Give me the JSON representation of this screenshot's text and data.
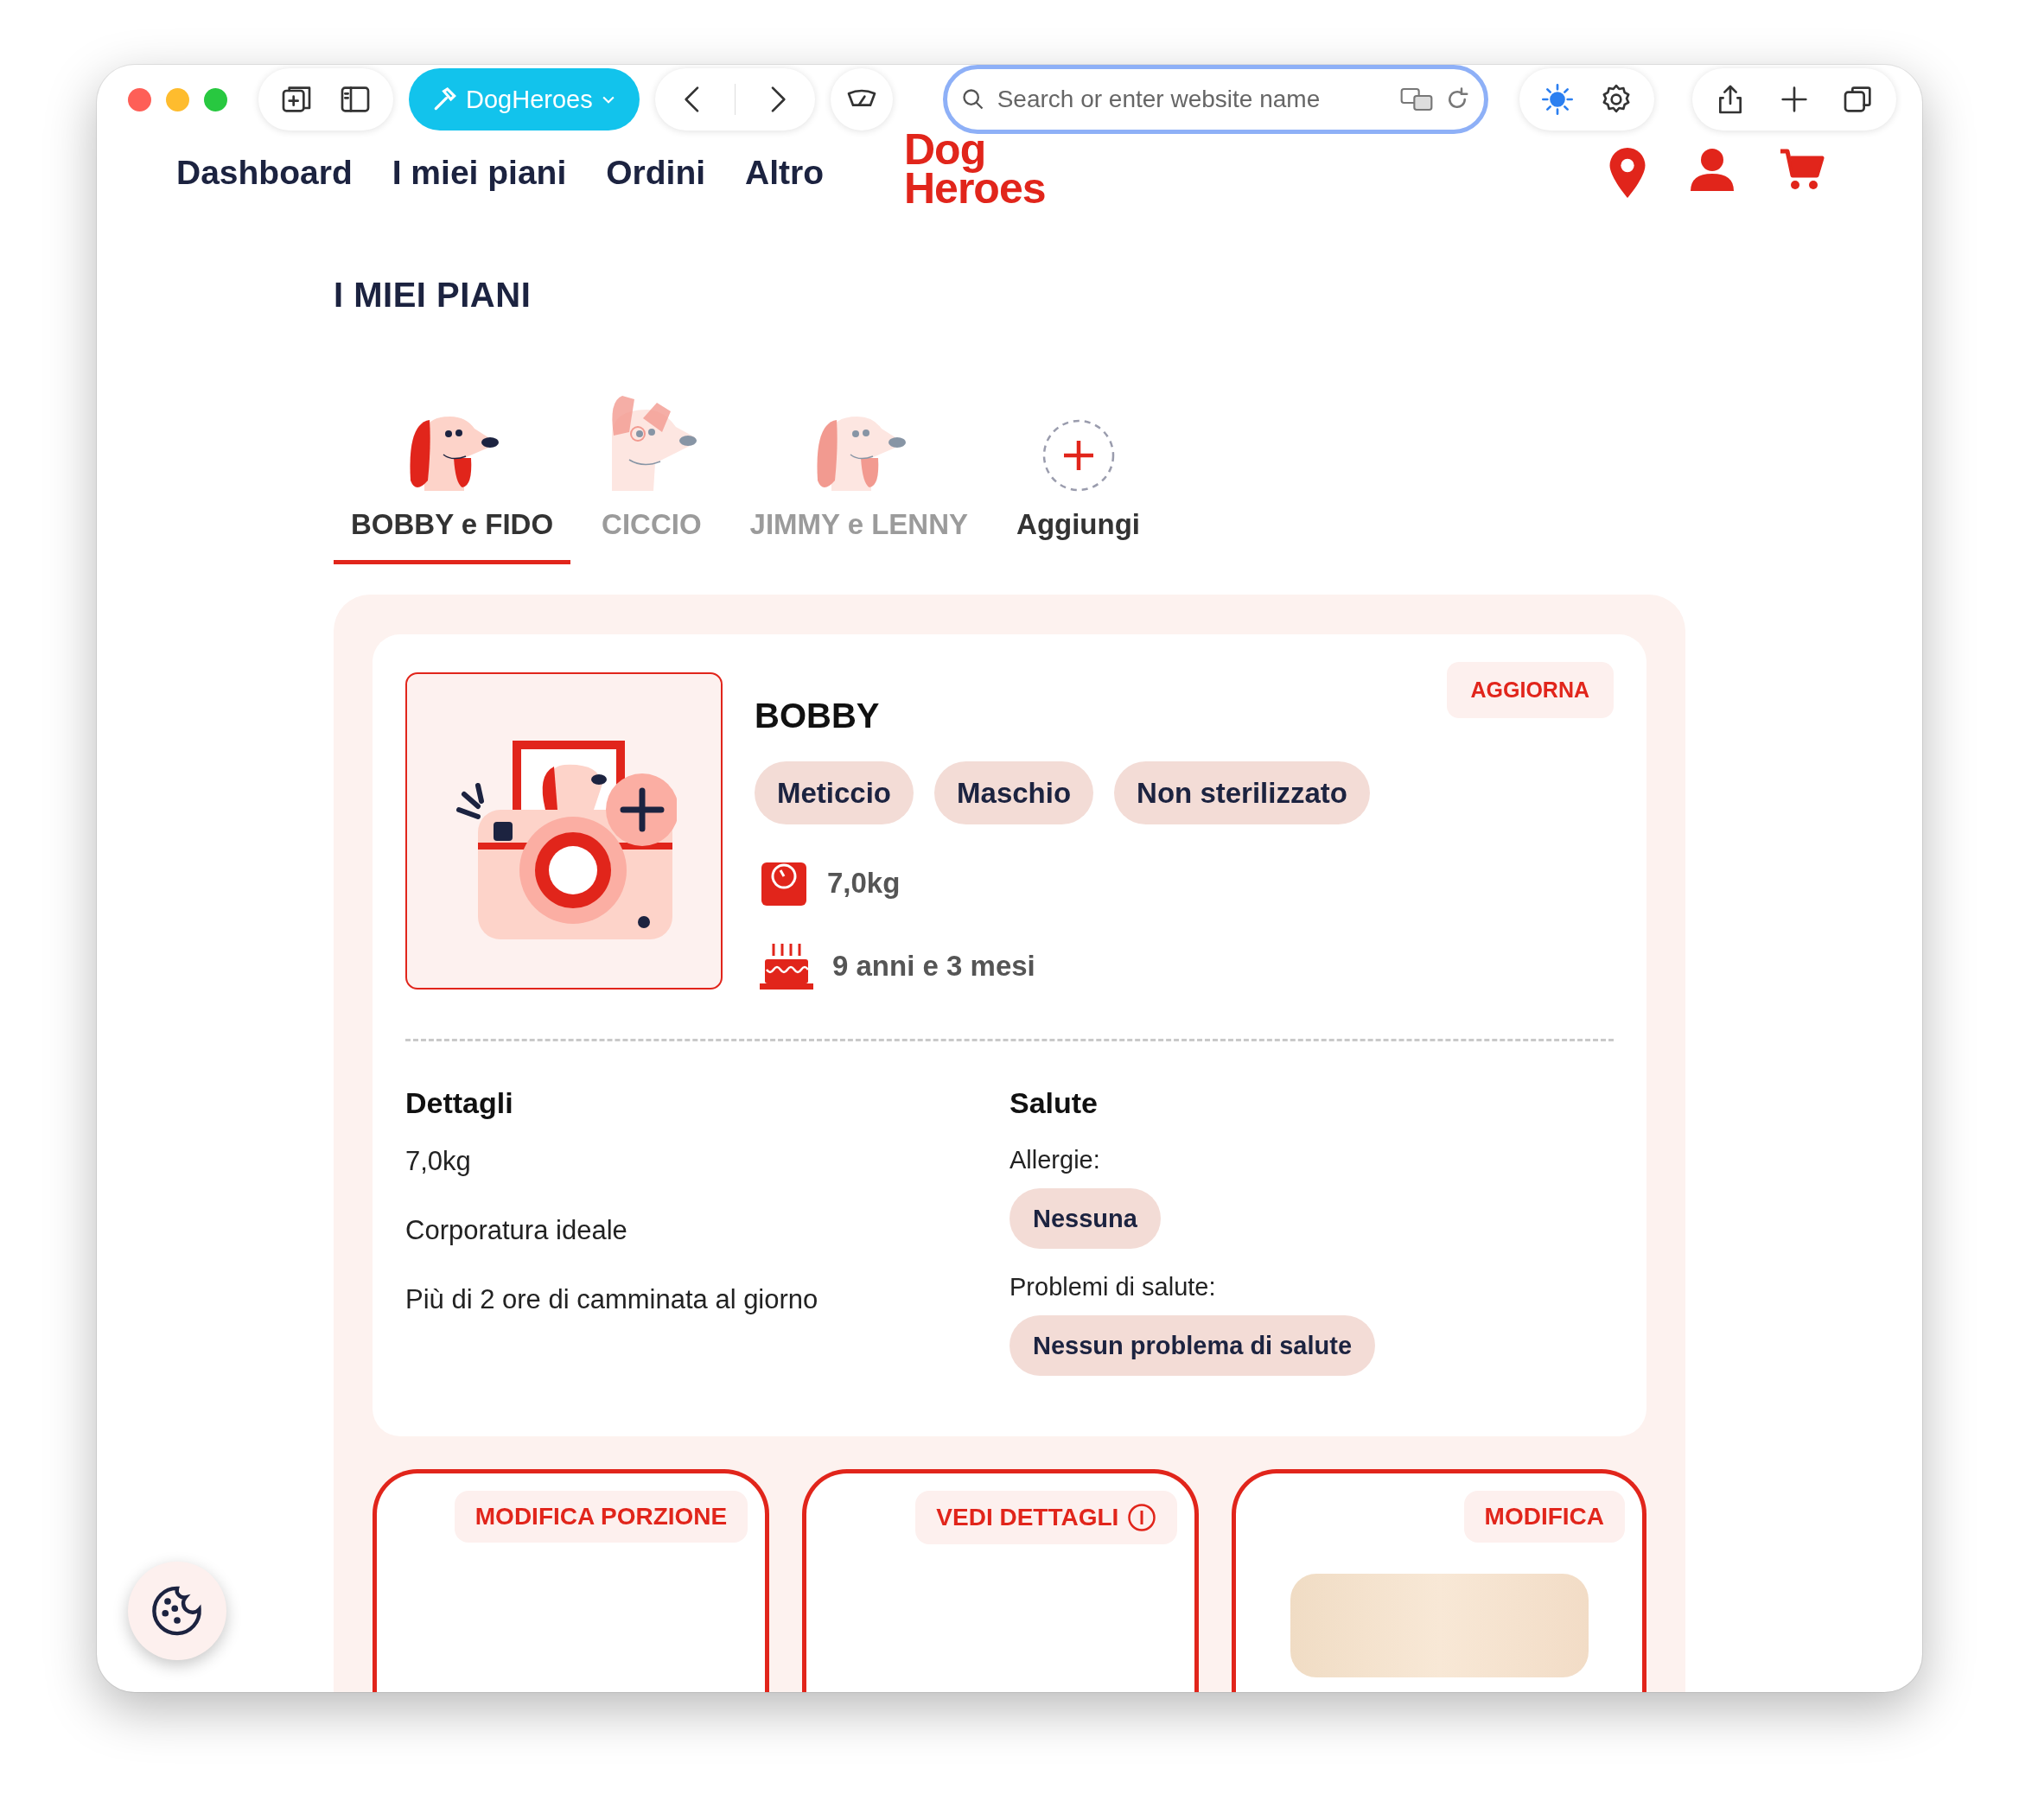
{
  "browser": {
    "tab_group": "DogHeroes",
    "address_placeholder": "Search or enter website name"
  },
  "nav": {
    "links": [
      "Dashboard",
      "I miei piani",
      "Ordini",
      "Altro"
    ],
    "logo": [
      "Dog",
      "Heroes"
    ]
  },
  "page_title": "I MIEI PIANI",
  "dog_tabs": [
    {
      "label": "BOBBY e FIDO",
      "selected": true,
      "kind": "floppy"
    },
    {
      "label": "CICCIO",
      "selected": false,
      "kind": "pointy"
    },
    {
      "label": "JIMMY e LENNY",
      "selected": false,
      "kind": "floppy"
    },
    {
      "label": "Aggiungi",
      "selected": false,
      "kind": "add"
    }
  ],
  "profile": {
    "name": "BOBBY",
    "update_button": "AGGIORNA",
    "tags": [
      "Meticcio",
      "Maschio",
      "Non sterilizzato"
    ],
    "facts": [
      {
        "kind": "weight",
        "text": "7,0kg"
      },
      {
        "kind": "age",
        "text": "9 anni e 3 mesi"
      }
    ]
  },
  "details": {
    "title": "Dettagli",
    "lines": [
      "7,0kg",
      "Corporatura ideale",
      "Più di 2 ore di camminata al giorno"
    ]
  },
  "health": {
    "title": "Salute",
    "groups": [
      {
        "label": "Allergie:",
        "tag": "Nessuna"
      },
      {
        "label": "Problemi di salute:",
        "tag": "Nessun problema di salute"
      }
    ]
  },
  "plan_cards": [
    {
      "button": "MODIFICA PORZIONE",
      "kind": "plain"
    },
    {
      "button": "VEDI DETTAGLI",
      "kind": "info"
    },
    {
      "button": "MODIFICA",
      "kind": "image"
    }
  ]
}
